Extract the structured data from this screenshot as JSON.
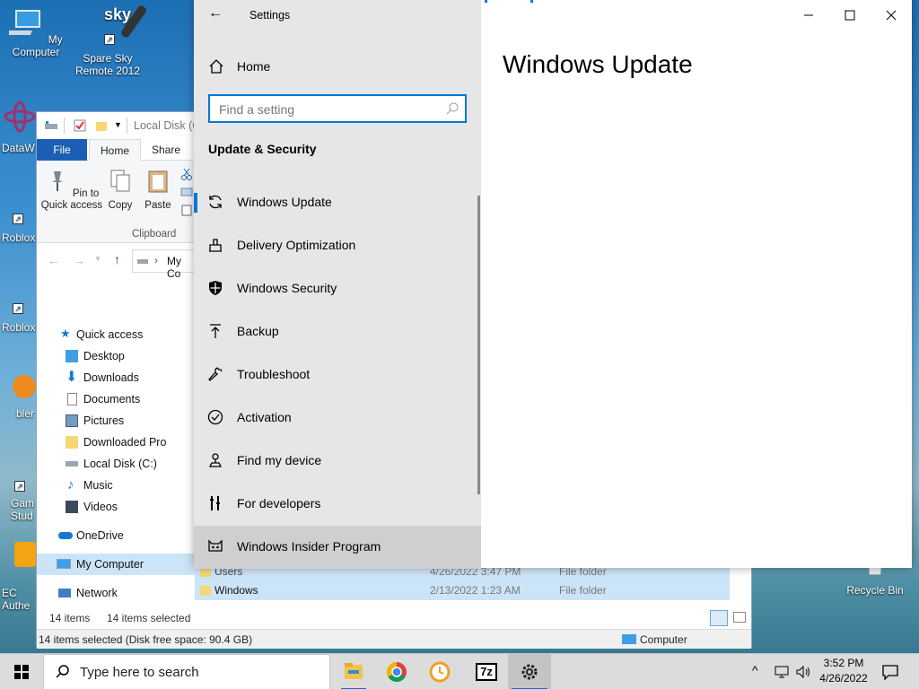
{
  "desktop": {
    "icons": [
      {
        "label": "My Computer"
      },
      {
        "label": "Spare Sky Remote 2012"
      },
      {
        "label": "Recycle Bin"
      }
    ],
    "clipped_labels": [
      "DataW",
      "Roblox",
      "Roblox",
      "bler",
      "Gam Stud",
      "EC Authe"
    ],
    "sky_logo": "sky"
  },
  "explorer": {
    "title": "Local Disk (C",
    "tabs": {
      "file": "File",
      "home": "Home",
      "share": "Share"
    },
    "ribbon": {
      "pin_label": "Pin to Quick access",
      "copy_label": "Copy",
      "paste_label": "Paste",
      "group_label": "Clipboard"
    },
    "address": "My Co",
    "nav": [
      {
        "label": "Quick access",
        "icon": "star-icon"
      },
      {
        "label": "Desktop",
        "icon": "desktop-folder-icon",
        "pinned": true
      },
      {
        "label": "Downloads",
        "icon": "downloads-icon",
        "pinned": true
      },
      {
        "label": "Documents",
        "icon": "documents-icon",
        "pinned": true
      },
      {
        "label": "Pictures",
        "icon": "pictures-icon",
        "pinned": true
      },
      {
        "label": "Downloaded Pro",
        "icon": "folder-icon",
        "pinned": true
      },
      {
        "label": "Local Disk (C:)",
        "icon": "drive-icon"
      },
      {
        "label": "Music",
        "icon": "music-icon"
      },
      {
        "label": "Videos",
        "icon": "videos-icon"
      },
      {
        "label": "OneDrive",
        "icon": "cloud-icon"
      },
      {
        "label": "My Computer",
        "icon": "computer-icon",
        "selected": true
      },
      {
        "label": "Network",
        "icon": "network-icon"
      }
    ],
    "files": [
      {
        "name": "Users",
        "date": "4/26/2022 3:47 PM",
        "type": "File folder"
      },
      {
        "name": "Windows",
        "date": "2/13/2022 1:23 AM",
        "type": "File folder"
      }
    ],
    "status": {
      "count": "14 items",
      "selected": "14 items selected"
    },
    "details_bar": {
      "text": "14 items selected (Disk free space: 90.4 GB)",
      "location": "Computer"
    }
  },
  "settings": {
    "window_title": "Settings",
    "home_label": "Home",
    "search_placeholder": "Find a setting",
    "section_title": "Update & Security",
    "main_title": "Windows Update",
    "items": [
      {
        "label": "Windows Update",
        "icon": "sync-icon",
        "current": true
      },
      {
        "label": "Delivery Optimization",
        "icon": "delivery-optimization-icon"
      },
      {
        "label": "Windows Security",
        "icon": "shield-icon"
      },
      {
        "label": "Backup",
        "icon": "backup-arrow-icon"
      },
      {
        "label": "Troubleshoot",
        "icon": "wrench-icon"
      },
      {
        "label": "Activation",
        "icon": "checkmark-circle-icon"
      },
      {
        "label": "Find my device",
        "icon": "find-device-icon"
      },
      {
        "label": "For developers",
        "icon": "developer-tools-icon"
      },
      {
        "label": "Windows Insider Program",
        "icon": "insider-cat-icon",
        "hover": true
      }
    ]
  },
  "taskbar": {
    "search_placeholder": "Type here to search",
    "apps": [
      "file-explorer-icon",
      "chrome-icon",
      "clock-app-icon",
      "7zip-icon",
      "settings-gear-icon"
    ],
    "app_7zip_label": "7z",
    "time": "3:52 PM",
    "date": "4/26/2022"
  },
  "colors": {
    "accent": "#0078d7",
    "explorer_file_tab": "#1a5fb4",
    "selection": "#cce4f7",
    "settings_sidebar": "#e6e6e6",
    "taskbar": "#dcdcdc"
  }
}
